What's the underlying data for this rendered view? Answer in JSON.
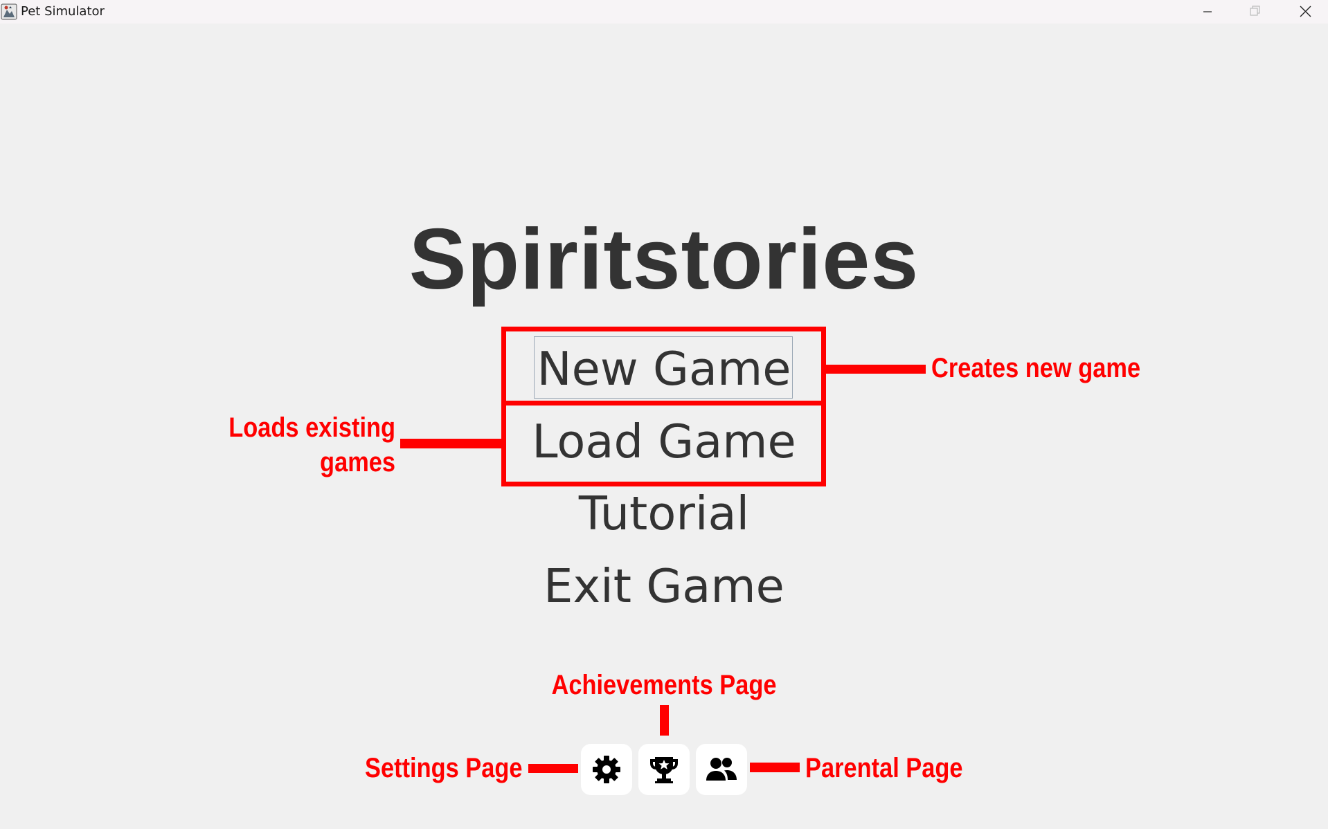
{
  "window": {
    "title": "Pet Simulator",
    "icon": "app-icon"
  },
  "main_menu": {
    "title": "Spiritstories",
    "new_game": "New Game",
    "load_game": "Load Game",
    "tutorial": "Tutorial",
    "exit_game": "Exit Game"
  },
  "icon_buttons": {
    "settings": "gear-icon",
    "achievements": "trophy-icon",
    "parental": "people-icon"
  },
  "annotations": {
    "color": "#ff0000",
    "creates_new_game": "Creates new game",
    "loads_existing_games_line1": "Loads existing",
    "loads_existing_games_line2": "games",
    "achievements_page": "Achievements Page",
    "settings_page": "Settings Page",
    "parental_page": "Parental Page"
  }
}
